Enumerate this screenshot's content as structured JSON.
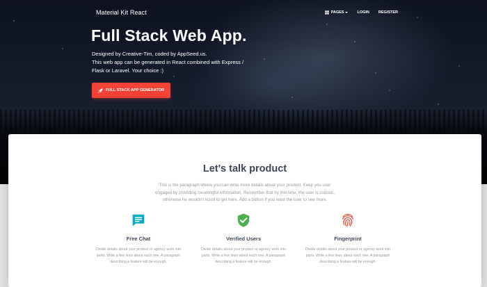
{
  "navbar": {
    "brand": "Material Kit React",
    "links": [
      {
        "label": "Pages",
        "icon": "pages-icon",
        "has_caret": true
      },
      {
        "label": "Login"
      },
      {
        "label": "Register"
      }
    ]
  },
  "hero": {
    "title": "Full Stack Web App.",
    "description_lines": [
      "Designed by Creative-Tim, coded by AppSeed.us.",
      "This web app can be generated in React combined with Express /",
      "Flask or Laravel. Your choice :)"
    ],
    "button": {
      "label": "Full Stack App Generator",
      "icon": "rocket-icon"
    }
  },
  "product": {
    "title": "Let's talk product",
    "description_lines": [
      "This is the paragraph where you can write more details about your product. Keep you user",
      "engaged by providing meaningful information. Remember that by this time, the user is curious,",
      "otherwise he wouldn't scroll to get here. Add a button if you want the user to see more."
    ],
    "features": [
      {
        "title": "Free Chat",
        "icon": "chat-icon",
        "text_lines": [
          "Divide details about your product or agency work into",
          "parts. Write a few lines about each one. A paragraph",
          "describing a feature will be enough."
        ]
      },
      {
        "title": "Verified Users",
        "icon": "verified-shield-icon",
        "text_lines": [
          "Divide details about your product or agency work into",
          "parts. Write a few lines about each one. A paragraph",
          "describing a feature will be enough."
        ]
      },
      {
        "title": "Fingerprint",
        "icon": "fingerprint-icon",
        "text_lines": [
          "Divide details about your product or agency work into",
          "parts. Write a few lines about each one. A paragraph",
          "describing a feature will be enough."
        ]
      }
    ]
  },
  "colors": {
    "accent_red": "#f44336",
    "chat_icon": "#00acc1",
    "verified_icon": "#4caf50",
    "fingerprint_icon": "#f44336",
    "heading": "#3c4858",
    "muted_text": "#999999"
  }
}
